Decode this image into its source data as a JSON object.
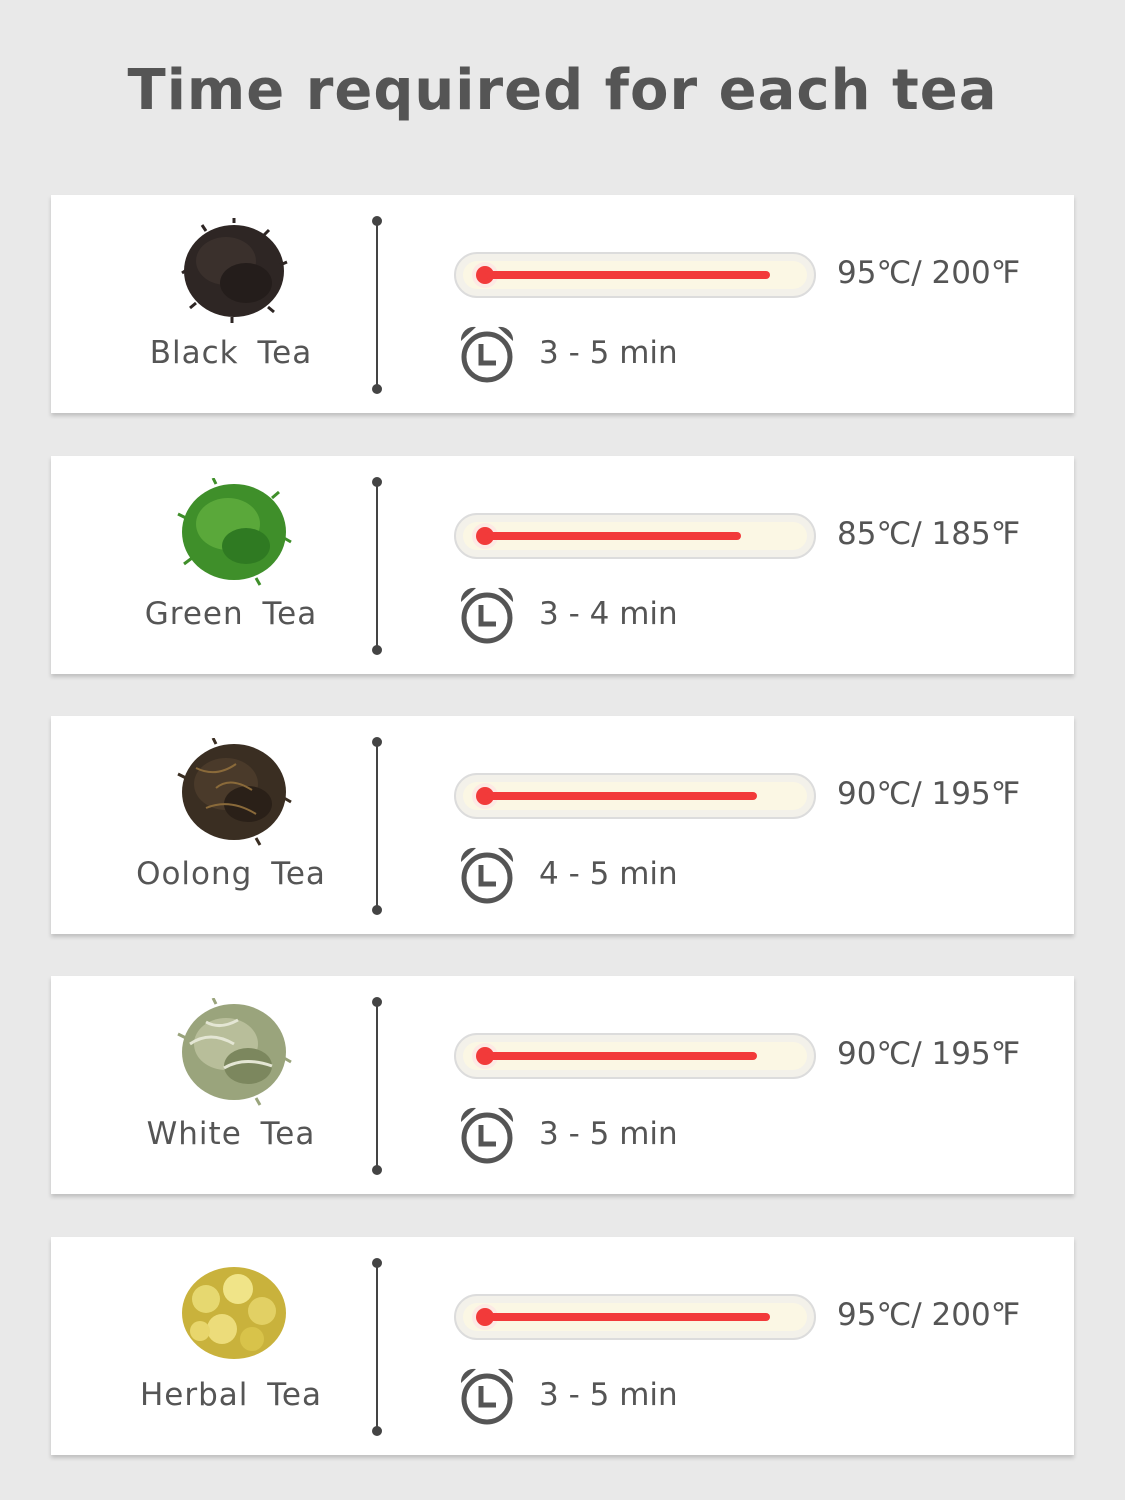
{
  "title": "Time required for each tea",
  "teas": [
    {
      "name": "Black  Tea",
      "temperature": "95℃/ 200℉",
      "time": "3 - 5 min",
      "fill": 0.89,
      "leaf_color": "#2e2624",
      "leaf_icon": "black-tea-leaves"
    },
    {
      "name": "Green  Tea",
      "temperature": "85℃/ 185℉",
      "time": "3 - 4 min",
      "fill": 0.8,
      "leaf_color": "#3f8f2a",
      "leaf_icon": "green-tea-leaves"
    },
    {
      "name": "Oolong  Tea",
      "temperature": "90℃/ 195℉",
      "time": "4 - 5 min",
      "fill": 0.85,
      "leaf_color": "#3a2e22",
      "leaf_icon": "oolong-tea-leaves"
    },
    {
      "name": "White  Tea",
      "temperature": "90℃/ 195℉",
      "time": "3 - 5 min",
      "fill": 0.85,
      "leaf_color": "#9aa47c",
      "leaf_icon": "white-tea-leaves"
    },
    {
      "name": "Herbal  Tea",
      "temperature": "95℃/ 200℉",
      "time": "3 - 5 min",
      "fill": 0.89,
      "leaf_color": "#d8c34a",
      "leaf_icon": "herbal-tea-flowers"
    }
  ],
  "colors": {
    "background": "#e9e9e9",
    "card": "#ffffff",
    "text": "#555555",
    "mercury": "#f23a3a",
    "tube": "#fbf7e4"
  },
  "icons": {
    "clock": "alarm-clock-icon",
    "thermometer": "thermometer-icon"
  }
}
